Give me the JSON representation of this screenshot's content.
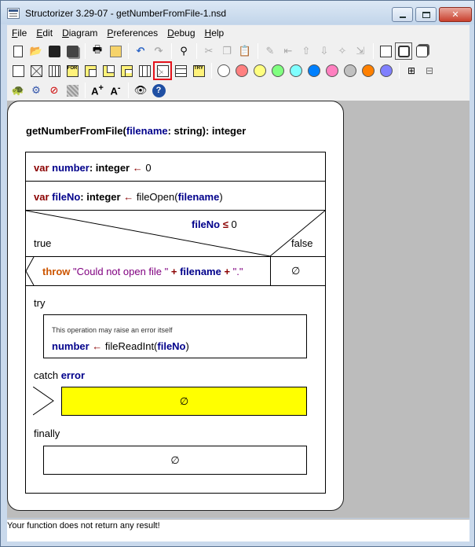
{
  "window": {
    "title": "Structorizer 3.29-07 - getNumberFromFile-1.nsd"
  },
  "menu": [
    {
      "label": "File",
      "mnemonic": "F",
      "rest": "ile"
    },
    {
      "label": "Edit",
      "mnemonic": "E",
      "rest": "dit"
    },
    {
      "label": "Diagram",
      "mnemonic": "D",
      "rest": "iagram"
    },
    {
      "label": "Preferences",
      "mnemonic": "P",
      "rest": "references"
    },
    {
      "label": "Debug",
      "mnemonic": "D",
      "rest": "ebug"
    },
    {
      "label": "Help",
      "mnemonic": "H",
      "rest": "elp"
    }
  ],
  "toolbar": {
    "colors": [
      "#ffffff",
      "#ff8080",
      "#ffff80",
      "#80ff80",
      "#80ffff",
      "#0080ff",
      "#ff80c0",
      "#c0c0c0",
      "#ff8000",
      "#8080ff"
    ],
    "for_label": "FOR",
    "try_label": "TRY",
    "font_up_label": "A",
    "font_down_label": "A"
  },
  "diagram": {
    "signature": {
      "name": "getNumberFromFile",
      "open": "(",
      "param": "filename",
      "sep": ": string): integer"
    },
    "var1": {
      "kw": "var",
      "name": "number",
      "type": ": integer",
      "arrow": " ← ",
      "value": "0"
    },
    "var2": {
      "kw": "var",
      "name": "fileNo",
      "type": ": integer",
      "arrow": " ← ",
      "call": "fileOpen(",
      "arg": "filename",
      "close": ")"
    },
    "alt": {
      "cond_var": "fileNo",
      "cond_op": " ≤ ",
      "cond_val": "0",
      "true_label": "true",
      "false_label": "false"
    },
    "throw_stmt": {
      "kw": "throw",
      "str1": " \"Could not open file \"",
      "plus1": " + ",
      "var": "filename",
      "plus2": " + ",
      "str2": "\".\""
    },
    "empty_symbol": "∅",
    "try": {
      "label": "try",
      "comment": "This operation may raise an error itself",
      "target": "number",
      "arrow": " ← ",
      "call": "fileReadInt(",
      "arg": "fileNo",
      "close": ")"
    },
    "catch": {
      "label": "catch",
      "var": "error"
    },
    "finally_label": "finally"
  },
  "status": {
    "text": "Your function does not return any result!"
  }
}
